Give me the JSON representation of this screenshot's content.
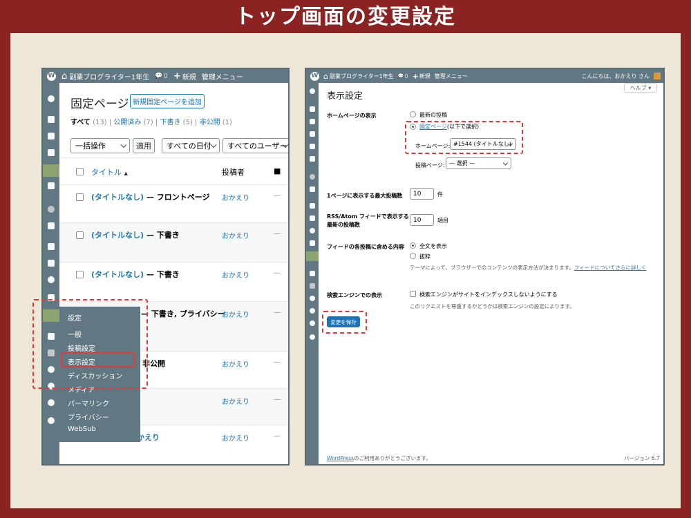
{
  "heading": "トップ画面の変更設定",
  "left": {
    "adminbar": {
      "logo": "W",
      "home_icon": "⌂",
      "site_name": "副業ブログライター1年生",
      "comment_icon": "💬",
      "comment_count": "0",
      "new_icon": "+",
      "new_label": "新規",
      "menu_label": "管理メニュー"
    },
    "page_title": "固定ページ",
    "add_button": "新規固定ページを追加",
    "filters": {
      "all": "すべて",
      "all_count": "(13)",
      "published": "公開済み",
      "published_count": "(7)",
      "draft": "下書き",
      "draft_count": "(5)",
      "private": "非公開",
      "private_count": "(1)",
      "sep": "|"
    },
    "bulk_action": "一括操作",
    "apply": "適用",
    "date_filter": "すべての日付",
    "user_filter": "すべてのユーザー",
    "columns": {
      "title": "タイトル",
      "sort_icon": "▲",
      "author": "投稿者"
    },
    "rows": [
      {
        "title": "(タイトルなし)",
        "state": "— フロントページ",
        "author": "おかえり",
        "dash": "—"
      },
      {
        "title": "(タイトルなし)",
        "state": "— 下書き",
        "author": "おかえり",
        "dash": "—"
      },
      {
        "title": "(タイトルなし)",
        "state": "— 下書き",
        "author": "おかえり",
        "dash": "—"
      },
      {
        "title": "",
        "state": "— 下書き, プライバシー",
        "author": "おかえり",
        "dash": "—"
      },
      {
        "title": "",
        "state": "非公開",
        "author": "おかえり",
        "dash": "—"
      },
      {
        "title": "",
        "state": "",
        "author": "おかえり",
        "dash": "—"
      },
      {
        "title": "",
        "state": "かえり",
        "author": "おかえり",
        "dash": "—"
      }
    ],
    "flyout": {
      "header": "設定",
      "items": [
        "一般",
        "投稿設定",
        "表示設定",
        "ディスカッション",
        "メディア",
        "パーマリンク",
        "プライバシー",
        "WebSub"
      ]
    }
  },
  "right": {
    "adminbar": {
      "logo": "W",
      "home_icon": "⌂",
      "site_name": "副業ブログライター1年生",
      "comment_icon": "💬",
      "comment_count": "0",
      "new_icon": "+",
      "new_label": "新規",
      "menu_label": "管理メニュー",
      "greeting": "こんにちは、おかえり さん"
    },
    "help": "ヘルプ ▾",
    "page_title": "表示設定",
    "homepage_label": "ホームページの表示",
    "opt_latest": "最新の投稿",
    "opt_static": "固定ページ",
    "opt_static_note": "(以下で選択)",
    "homepage_select_label": "ホームページ:",
    "homepage_select_value": "#1544 (タイトルなし)",
    "posts_page_label": "投稿ページ:",
    "posts_page_value": "— 選択 —",
    "per_page_label": "1ページに表示する最大投稿数",
    "per_page_value": "10",
    "per_page_unit": "件",
    "rss_label_1": "RSS/Atom フィードで表示する",
    "rss_label_2": "最新の投稿数",
    "rss_value": "10",
    "rss_unit": "項目",
    "feed_label": "フィードの各投稿に含める内容",
    "feed_full": "全文を表示",
    "feed_excerpt": "抜粋",
    "feed_note": "テーマによって、ブラウザーでのコンテンツの表示方法が決まります。",
    "feed_link": "フィードについてさらに詳しく",
    "search_label": "検索エンジンでの表示",
    "search_cb": "検索エンジンがサイトをインデックスしないようにする",
    "search_note": "このリクエストを尊重するかどうかは検索エンジンの設定によります。",
    "save": "変更を保存",
    "footer_link": "WordPress",
    "footer_text": "のご利用ありがとうございます。",
    "version": "バージョン 6.7"
  }
}
